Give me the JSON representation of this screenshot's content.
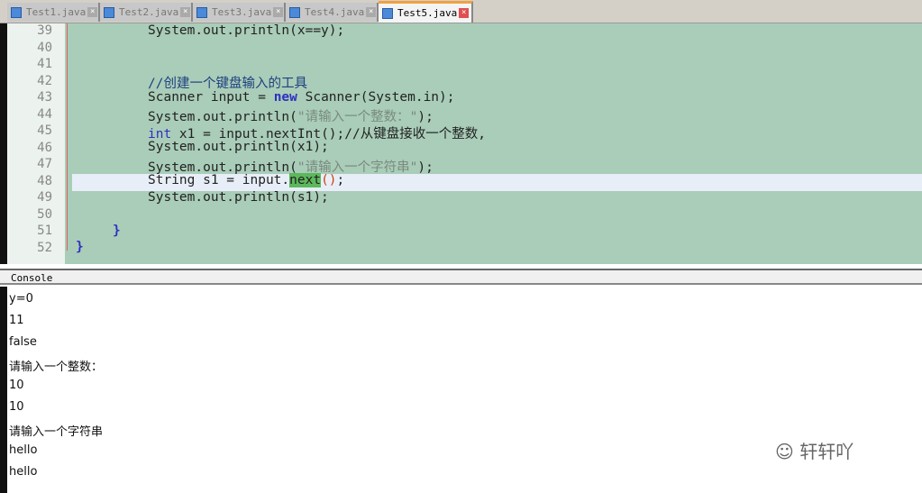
{
  "tabs": [
    {
      "label": "Test1.java"
    },
    {
      "label": "Test2.java"
    },
    {
      "label": "Test3.java"
    },
    {
      "label": "Test4.java"
    },
    {
      "label": "Test5.java",
      "active": true
    }
  ],
  "editor": {
    "line_numbers": [
      "39",
      "40",
      "41",
      "42",
      "43",
      "44",
      "45",
      "46",
      "47",
      "48",
      "49",
      "50",
      "51",
      "52"
    ],
    "lines": {
      "l39": "System.out.println(x==y);",
      "l42": "//创建一个键盘输入的工具",
      "l43a": "Scanner input = ",
      "l43kw": "new",
      "l43b": " Scanner(System.in);",
      "l44a": "System.out.println(",
      "l44s": "\"请输入一个整数：\"",
      "l44b": ");",
      "l45kw": "int",
      "l45b": " x1 = input.nextInt();//从键盘接收一个整数,",
      "l46": "System.out.println(x1);",
      "l47a": "System.out.println(",
      "l47s": "\"请输入一个字符串\"",
      "l47b": ");",
      "l48a": "String s1 = input.",
      "l48h": "next",
      "l48p": "()",
      "l48b": ";",
      "l49": "System.out.println(s1);",
      "l51": "}",
      "l52": "}"
    }
  },
  "console": {
    "title": "Console",
    "output": [
      "y=0",
      "11",
      "false",
      "请输入一个整数：",
      "10",
      "10",
      "请输入一个字符串",
      "hello",
      "hello"
    ]
  },
  "watermark": "轩轩吖",
  "colors": {
    "editor_bg": "#a9cdb8",
    "keyword": "#3030c0",
    "match_highlight": "#5cb85c"
  }
}
